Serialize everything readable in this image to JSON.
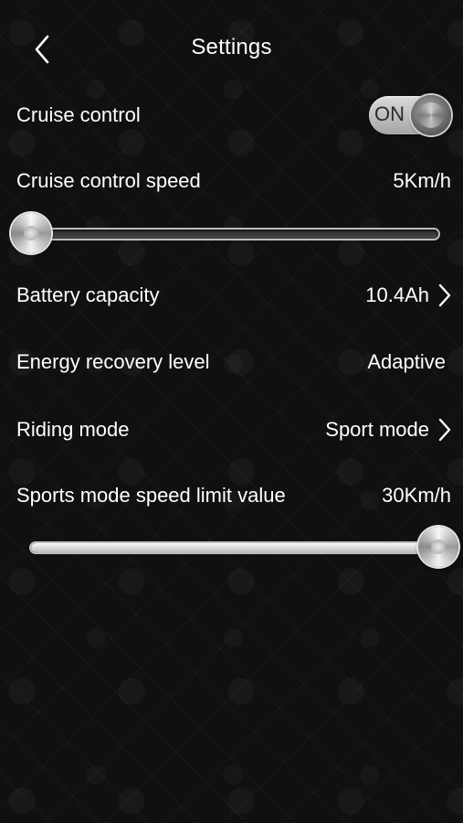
{
  "header": {
    "title": "Settings"
  },
  "cruise_control": {
    "label": "Cruise control",
    "toggle_text": "ON",
    "enabled": true
  },
  "cruise_speed": {
    "label": "Cruise control speed",
    "value": "5Km/h",
    "slider_fraction": 0.0
  },
  "battery": {
    "label": "Battery capacity",
    "value": "10.4Ah"
  },
  "energy_recovery": {
    "label": "Energy recovery level",
    "value": "Adaptive"
  },
  "riding_mode": {
    "label": "Riding mode",
    "value": "Sport mode"
  },
  "sports_limit": {
    "label": "Sports mode speed limit value",
    "value": "30Km/h",
    "slider_fraction": 1.0
  },
  "icons": {
    "back": "chevron-left-icon",
    "battery_nav": "chevron-right-icon",
    "riding_mode_nav": "chevron-right-icon"
  },
  "colors": {
    "background": "#101010",
    "text": "#ffffff"
  }
}
